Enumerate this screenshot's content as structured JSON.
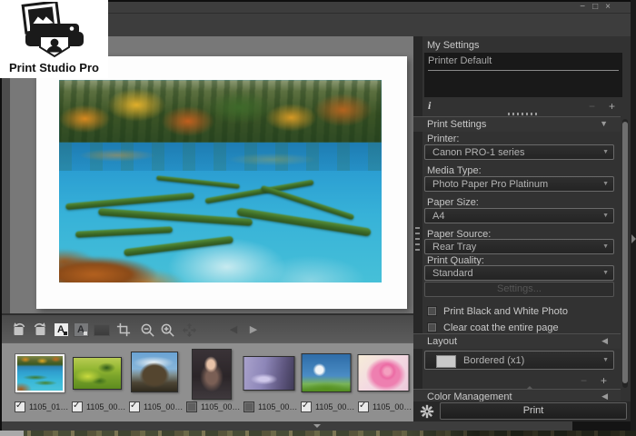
{
  "titlebar": {
    "minimize": "−",
    "maximize": "□",
    "close": "×"
  },
  "logo": {
    "title": "Print Studio Pro"
  },
  "icons": {
    "panel_expanded": "▼",
    "panel_collapsed": "◀",
    "filmstrip_collapse": "▼",
    "previous_arrow": "◀",
    "next_arrow": "▶",
    "dropdown_arrow": "▼",
    "info": "i",
    "remove": "−",
    "add": "+",
    "toolbar": [
      {
        "name": "rotate-left",
        "enabled": true
      },
      {
        "name": "rotate-right",
        "enabled": true
      },
      {
        "name": "correction-a-light",
        "enabled": true,
        "active": true
      },
      {
        "name": "correction-a-dark",
        "enabled": true
      },
      {
        "name": "preview-box",
        "enabled": false
      },
      {
        "name": "crop",
        "enabled": true
      },
      {
        "name": "zoom-out",
        "enabled": true
      },
      {
        "name": "zoom-in",
        "enabled": true
      },
      {
        "name": "fit-to-window",
        "enabled": false
      },
      {
        "name": "previous-page",
        "enabled": false
      },
      {
        "name": "next-page",
        "enabled": true
      }
    ]
  },
  "my_settings": {
    "title": "My Settings",
    "items": [
      {
        "label": "Printer Default"
      }
    ]
  },
  "print_settings": {
    "title": "Print Settings",
    "fields": [
      {
        "label": "Printer:",
        "value": "Canon PRO-1 series"
      },
      {
        "label": "Media Type:",
        "value": "Photo Paper Pro Platinum"
      },
      {
        "label": "Paper Size:",
        "value": "A4"
      },
      {
        "label": "Paper Source:",
        "value": "Rear Tray"
      },
      {
        "label": "Print Quality:",
        "value": "Standard"
      }
    ],
    "settings_button": "Settings...",
    "checkboxes": [
      {
        "label": "Print Black and White Photo",
        "checked": false
      },
      {
        "label": "Clear coat the entire page",
        "checked": false
      }
    ]
  },
  "layout_panel": {
    "title": "Layout",
    "selected": "Bordered (x1)"
  },
  "color_management": {
    "title": "Color Management"
  },
  "actions": {
    "print_button": "Print"
  },
  "filmstrip": {
    "items": [
      {
        "name": "1105_01…",
        "checked": true,
        "selected": true
      },
      {
        "name": "1105_00…",
        "checked": true,
        "selected": false
      },
      {
        "name": "1105_00…",
        "checked": true,
        "selected": false
      },
      {
        "name": "1105_00…",
        "checked": false,
        "selected": false
      },
      {
        "name": "1105_00…",
        "checked": false,
        "selected": false
      },
      {
        "name": "1105_00…",
        "checked": true,
        "selected": false
      },
      {
        "name": "1105_00…",
        "checked": true,
        "selected": false
      }
    ]
  },
  "colors": {
    "sidebar_bg": "#323232",
    "canvas_bg": "#787878",
    "paper": "#fdfdfd",
    "titlebar": "#3d3d3d",
    "filmstrip_bg": "#8f8f8f"
  }
}
